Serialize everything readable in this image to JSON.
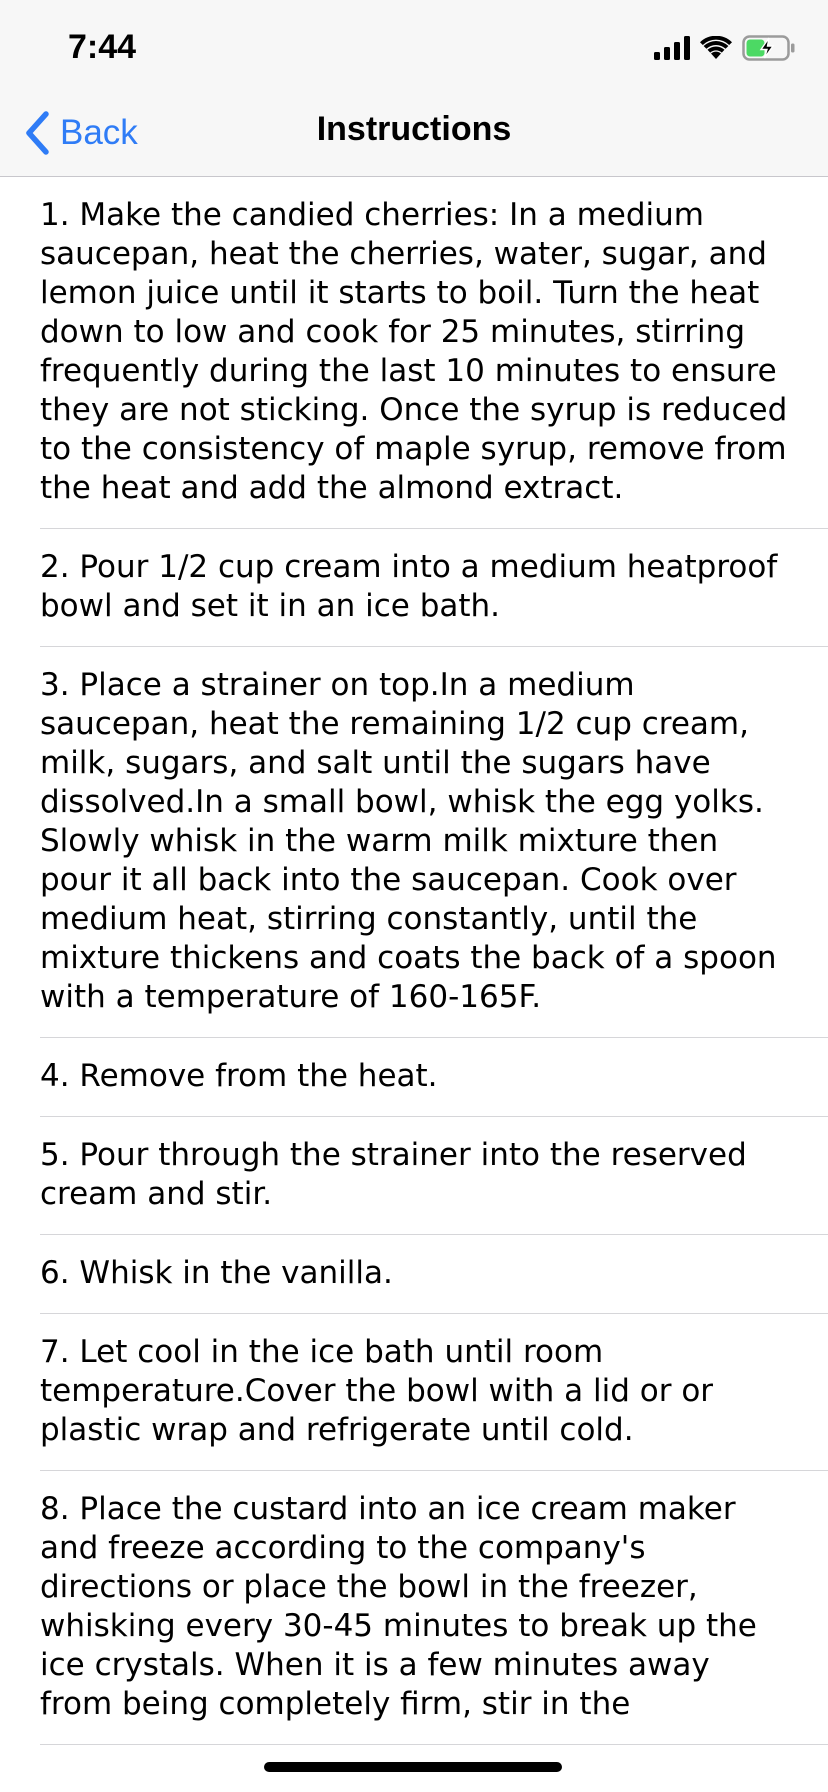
{
  "status_bar": {
    "time": "7:44",
    "battery_charging": true,
    "battery_color": "#4cd964"
  },
  "nav": {
    "back_label": "Back",
    "title": "Instructions",
    "accent_color": "#2f7cf6"
  },
  "steps": [
    "1. Make the candied cherries: In a medium saucepan, heat the cherries, water, sugar, and lemon juice until it starts to boil. Turn the heat down to low and cook for 25 minutes, stirring frequently during the last 10 minutes to ensure they are not sticking. Once the syrup is reduced to the consistency of maple syrup, remove from the heat and add the almond extract.",
    "2. Pour 1/2 cup cream into a medium heatproof bowl and set it in an ice bath.",
    "3. Place a strainer on top.In a medium saucepan, heat the remaining 1/2 cup cream, milk, sugars, and salt until the sugars have dissolved.In a small bowl, whisk the egg yolks. Slowly whisk in the warm milk mixture then pour it all back into the saucepan. Cook over medium heat, stirring constantly, until the mixture thickens and coats the back of a spoon with a temperature of 160-165F.",
    "4. Remove from the heat.",
    "5. Pour through the strainer into the reserved cream and stir.",
    "6. Whisk in the vanilla.",
    "7. Let cool in the ice bath until room temperature.Cover the bowl with a lid or or plastic wrap and refrigerate until cold.",
    "8. Place the custard into an ice cream maker and freeze according to the company's directions or place the bowl in the freezer, whisking every 30-45 minutes to break up the ice crystals. When it is a few minutes away from being completely firm, stir in the"
  ]
}
